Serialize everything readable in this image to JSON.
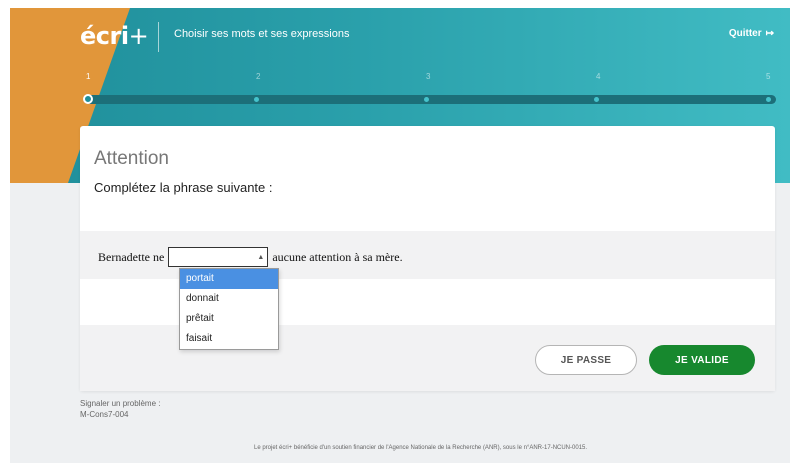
{
  "header": {
    "logo_main": "écri",
    "logo_plus": "+",
    "title": "Choisir ses mots et ses expressions",
    "quit_label": "Quitter",
    "quit_icon": "exit-arrow-icon"
  },
  "progress": {
    "steps": [
      "1",
      "2",
      "3",
      "4",
      "5"
    ],
    "current_step": 1
  },
  "question": {
    "title": "Attention",
    "instruction": "Complétez la phrase suivante :",
    "sentence_before": "Bernadette ne",
    "sentence_after": "aucune attention à sa mère.",
    "select_value": "",
    "options": [
      "portait",
      "donnait",
      "prêtait",
      "faisait"
    ],
    "highlighted_option": "portait"
  },
  "actions": {
    "pass_label": "JE PASSE",
    "validate_label": "JE VALIDE"
  },
  "report": {
    "label": "Signaler un problème :",
    "code": "M-Cons7-004"
  },
  "legal": {
    "text": "Le projet écri+ bénéficie d'un soutien financier de l'Agence Nationale de la Recherche (ANR), sous le n°ANR-17-NCUN-0015."
  },
  "colors": {
    "teal": "#2aa0ab",
    "orange": "#e1963a",
    "green": "#17882e",
    "highlight": "#4a90e2"
  }
}
